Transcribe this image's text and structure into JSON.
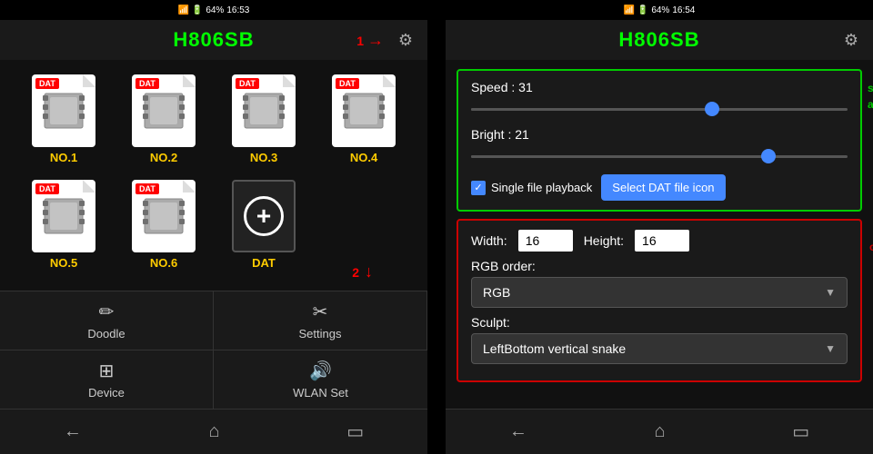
{
  "left_phone": {
    "status_bar": {
      "time": "16:53",
      "battery": "64%"
    },
    "header": {
      "title": "H806SB",
      "gear_label": "⚙"
    },
    "annotation1": "1",
    "dat_files": [
      {
        "label": "NO.1",
        "tag": "DAT",
        "has_film": true
      },
      {
        "label": "NO.2",
        "tag": "DAT",
        "has_film": true
      },
      {
        "label": "NO.3",
        "tag": "DAT",
        "has_film": true
      },
      {
        "label": "NO.4",
        "tag": "DAT",
        "has_film": true
      },
      {
        "label": "NO.5",
        "tag": "DAT",
        "has_film": true
      },
      {
        "label": "NO.6",
        "tag": "DAT",
        "has_film": true
      },
      {
        "label": "DAT",
        "tag": null,
        "has_film": false,
        "is_add": true
      }
    ],
    "annotation2": "2",
    "nav": {
      "items": [
        {
          "icon": "✏",
          "label": "Doodle"
        },
        {
          "icon": "✂",
          "label": "Settings"
        },
        {
          "icon": "⊞",
          "label": "Device"
        },
        {
          "icon": "🔊",
          "label": "WLAN Set"
        }
      ],
      "bottom_buttons": [
        "←",
        "⌂",
        "▭"
      ]
    }
  },
  "right_phone": {
    "status_bar": {
      "time": "16:54",
      "battery": "64%"
    },
    "header": {
      "title": "H806SB",
      "gear_label": "⚙"
    },
    "speed_bright": {
      "speed_label": "Speed : 31",
      "bright_label": "Bright : 21",
      "speed_value": 31,
      "bright_value": 21,
      "speed_percent": 65,
      "bright_percent": 80,
      "single_playback_label": "Single file playback",
      "select_dat_btn": "Select DAT file icon"
    },
    "doodle": {
      "width_label": "Width:",
      "width_value": "16",
      "height_label": "Height:",
      "height_value": "16",
      "rgb_label": "RGB order:",
      "rgb_value": "RGB",
      "sculpt_label": "Sculpt:",
      "sculpt_value": "LeftBottom vertical snake"
    },
    "annotation_green": "set speed,bright\nand play mode",
    "annotation_red": "only for doodle",
    "bottom_buttons": [
      "←",
      "⌂",
      "▭"
    ]
  }
}
